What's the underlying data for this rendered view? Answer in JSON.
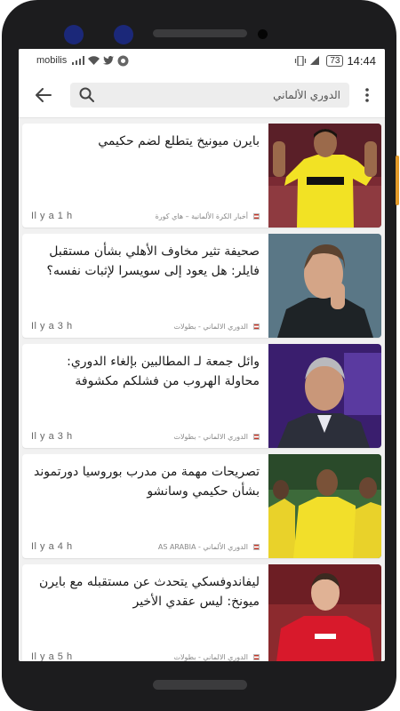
{
  "status_bar": {
    "carrier": "mobilis",
    "battery": "73",
    "time": "14:44"
  },
  "appbar": {
    "search_value": "الدوري الألماني"
  },
  "articles": [
    {
      "title": "بايرن ميونيخ يتطلع لضم حكيمي",
      "source": "أخبار الكرة الألمانية – هاي كورة",
      "age": "Il y a 1 h",
      "image": "player-yellow-jersey-photo"
    },
    {
      "title": "صحيفة تثير مخاوف الأهلي بشأن مستقبل فايلر: هل يعود إلى سويسرا لإثبات نفسه؟",
      "source": "الدوري الالماني - بطولات",
      "age": "Il y a 3 h",
      "image": "coach-portrait-photo"
    },
    {
      "title": "وائل جمعة لـ المطالبين بإلغاء الدوري: محاولة الهروب من فشلكم مكشوفة",
      "source": "الدوري الالماني - بطولات",
      "age": "Il y a 3 h",
      "image": "tv-studio-guest-photo"
    },
    {
      "title": "تصريحات مهمة من مدرب بوروسيا دورتموند بشأن حكيمي وسانشو",
      "source": "الدوري الألماني - AS ARABIA",
      "age": "Il y a 4 h",
      "image": "team-celebration-photo"
    },
    {
      "title": "ليفاندوفسكي يتحدث عن مستقبله مع بايرن ميونخ: ليس عقدي الأخير",
      "source": "الدوري الالماني - بطولات",
      "age": "Il y a 5 h",
      "image": "player-red-jersey-photo"
    }
  ]
}
